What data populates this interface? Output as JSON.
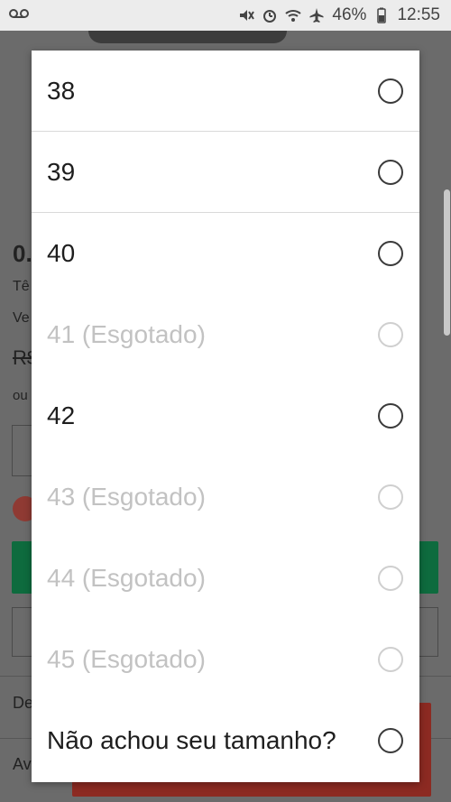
{
  "status_bar": {
    "voicemail_icon": "voicemail-icon",
    "battery_percent": "46%",
    "time": "12:55"
  },
  "background_page": {
    "title_fragment": "0.",
    "line1_fragment": "Tê",
    "line2_fragment": "Ve",
    "old_price_fragment": "R$",
    "installments_fragment": "ou",
    "section1_fragment": "De",
    "section2_fragment": "Av"
  },
  "size_picker": {
    "options": [
      {
        "label": "38",
        "available": true
      },
      {
        "label": "39",
        "available": true
      },
      {
        "label": "40",
        "available": true
      },
      {
        "label": "41 (Esgotado)",
        "available": false
      },
      {
        "label": "42",
        "available": true
      },
      {
        "label": "43 (Esgotado)",
        "available": false
      },
      {
        "label": "44 (Esgotado)",
        "available": false
      },
      {
        "label": "45 (Esgotado)",
        "available": false
      },
      {
        "label": "Não achou seu tamanho?",
        "available": true
      }
    ]
  }
}
